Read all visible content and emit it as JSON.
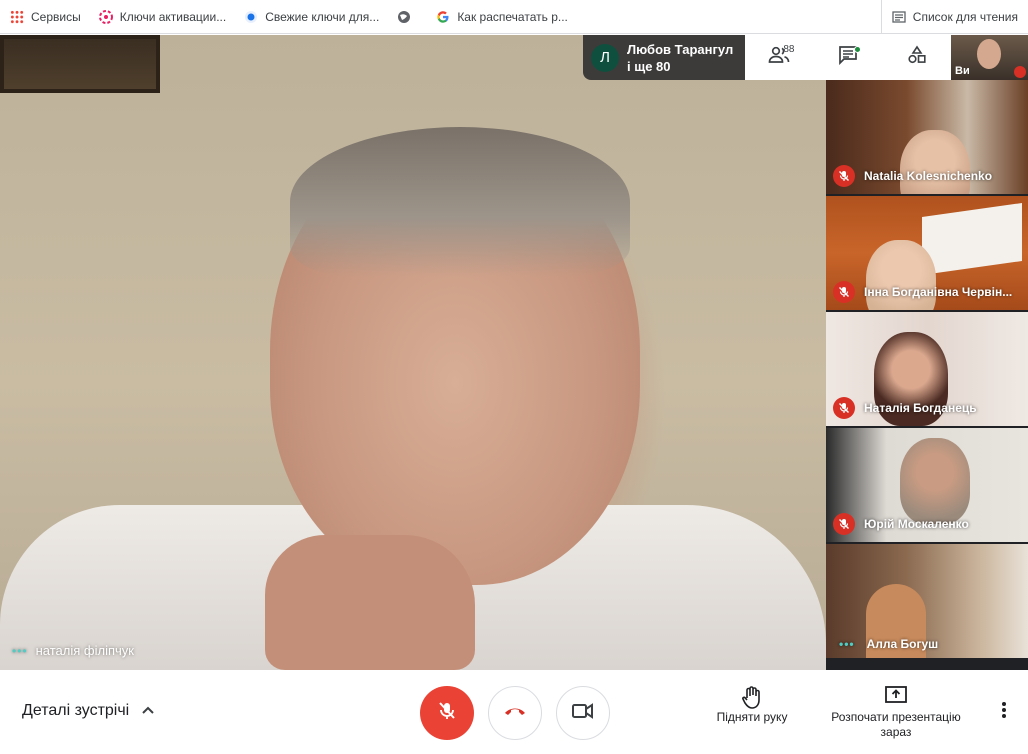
{
  "bookmarks": {
    "items": [
      {
        "label": "Сервисы",
        "icon": "apps-grid-icon"
      },
      {
        "label": "Ключи активации...",
        "icon": "flower-icon"
      },
      {
        "label": "Свежие ключи для...",
        "icon": "globe-blue-icon"
      },
      {
        "label": "",
        "icon": "globe-icon"
      },
      {
        "label": "Как распечатать р...",
        "icon": "google-g-icon"
      }
    ],
    "reading_list": "Список для чтения"
  },
  "stage": {
    "speaker_name": "наталія філіпчук"
  },
  "info_chip": {
    "avatar_letter": "Л",
    "line1": "Любов Тарангул",
    "line2": "і ще 80"
  },
  "topbar": {
    "people_count": "88"
  },
  "self_tile": {
    "label": "Ви"
  },
  "tiles": [
    {
      "name": "Natalia Kolesnichenko",
      "muted": true
    },
    {
      "name": "Інна Богданівна Червін...",
      "muted": true
    },
    {
      "name": "Наталія Богданець",
      "muted": true
    },
    {
      "name": "Юрій Москаленко",
      "muted": true
    },
    {
      "name": "Алла Богуш",
      "muted": false
    }
  ],
  "bottombar": {
    "details_label": "Деталі зустрічі",
    "raise_hand_label": "Підняти руку",
    "present_label": "Розпочати презентацію зараз"
  },
  "colors": {
    "accent_red": "#ea4335",
    "mic_muted_red": "#d93025",
    "activity_teal": "#4ecdc4"
  }
}
